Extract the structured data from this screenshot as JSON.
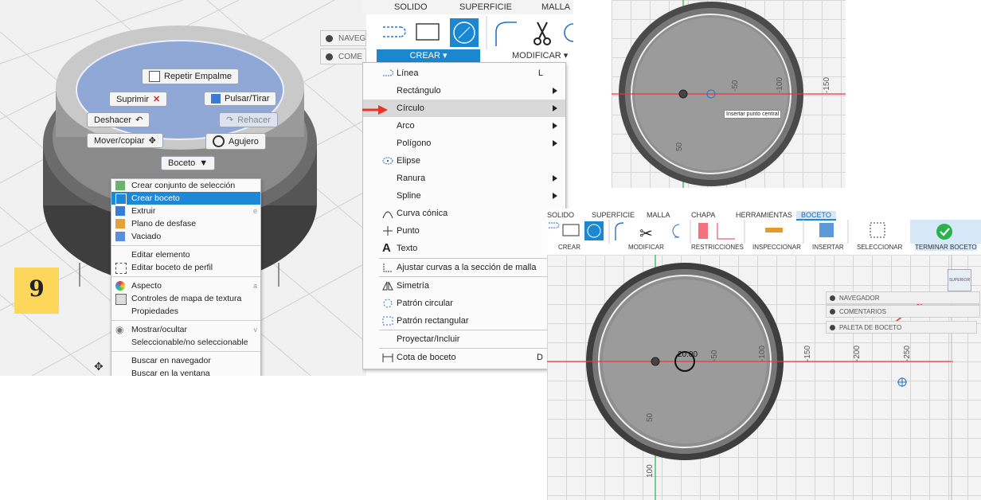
{
  "step_badge": "9",
  "panel1": {
    "nav_mini": [
      "NAVEG",
      "COME"
    ],
    "marking_menu": {
      "repeat": "Repetir Empalme",
      "delete": "Suprimir",
      "push_pull": "Pulsar/Tirar",
      "undo": "Deshacer",
      "redo": "Rehacer",
      "move": "Mover/copiar",
      "hole": "Agujero",
      "sketch": "Boceto"
    },
    "context_menu": {
      "groups": [
        [
          {
            "label": "Crear conjunto de selección",
            "icon": "selection-set-icon"
          },
          {
            "label": "Crear boceto",
            "icon": "sketch-icon",
            "selected": true
          },
          {
            "label": "Extruir",
            "icon": "extrude-icon",
            "shortcut": "e"
          },
          {
            "label": "Plano de desfase",
            "icon": "offset-plane-icon"
          },
          {
            "label": "Vaciado",
            "icon": "shell-icon"
          }
        ],
        [
          {
            "label": "Editar elemento",
            "icon": ""
          },
          {
            "label": "Editar boceto de perfil",
            "icon": "edit-profile-icon"
          }
        ],
        [
          {
            "label": "Aspecto",
            "icon": "appearance-icon",
            "shortcut": "a"
          },
          {
            "label": "Controles de mapa de textura",
            "icon": "texture-icon"
          },
          {
            "label": "Propiedades",
            "icon": ""
          }
        ],
        [
          {
            "label": "Mostrar/ocultar",
            "icon": "eye-icon",
            "shortcut": "v"
          },
          {
            "label": "Seleccionable/no seleccionable",
            "icon": ""
          }
        ],
        [
          {
            "label": "Buscar en navegador",
            "icon": ""
          },
          {
            "label": "Buscar en la ventana",
            "icon": ""
          }
        ]
      ]
    }
  },
  "panel2": {
    "tabs": [
      "SOLIDO",
      "SUPERFICIE",
      "MALLA"
    ],
    "crear": "CREAR",
    "modificar": "MODIFICAR",
    "items": [
      {
        "label": "Línea",
        "key": "L",
        "icon": "line-icon"
      },
      {
        "label": "Rectángulo",
        "sub": true
      },
      {
        "label": "Círculo",
        "sub": true,
        "highlight": true
      },
      {
        "label": "Arco",
        "sub": true
      },
      {
        "label": "Polígono",
        "sub": true
      },
      {
        "label": "Elipse",
        "icon": "ellipse-icon"
      },
      {
        "label": "Ranura",
        "sub": true
      },
      {
        "label": "Spline",
        "sub": true
      },
      {
        "label": "Curva cónica",
        "icon": "conic-icon"
      },
      {
        "label": "Punto",
        "icon": "point-icon"
      },
      {
        "label": "Texto",
        "icon": "text-icon"
      },
      {
        "label": "Ajustar curvas a la sección de malla",
        "icon": "fit-curves-icon",
        "sep_before": true
      },
      {
        "label": "Simetría",
        "icon": "mirror-icon",
        "sep_before": true
      },
      {
        "label": "Patrón circular",
        "icon": "circular-pattern-icon"
      },
      {
        "label": "Patrón rectangular",
        "icon": "rect-pattern-icon"
      },
      {
        "label": "Proyectar/Incluir",
        "sep_before": true
      },
      {
        "label": "Cota de boceto",
        "key": "D",
        "icon": "dimension-icon",
        "sep_before": true
      }
    ]
  },
  "panel3": {
    "tooltip": "Insertar punto central",
    "labels": [
      "-50",
      "-100",
      "-150",
      "50"
    ]
  },
  "panel4": {
    "tabs": [
      "SOLIDO",
      "SUPERFICIE",
      "MALLA",
      "CHAPA",
      "HERRAMIENTAS",
      "BOCETO"
    ],
    "active_tab": "BOCETO",
    "groups": [
      "CREAR",
      "MODIFICAR",
      "RESTRICCIONES",
      "INSPECCIONAR",
      "INSERTAR",
      "SELECCIONAR",
      "TERMINAR BOCETO"
    ],
    "side_panels": [
      "NAVEGADOR",
      "COMENTARIOS",
      "PALETA DE BOCETO"
    ],
    "viewcube": "SUPERIOR",
    "dim_value": "20.00",
    "axis_labels": [
      "-50",
      "-100",
      "-150",
      "-200",
      "-250",
      "50",
      "100"
    ]
  },
  "colors": {
    "accent": "#1b87d0",
    "selected": "#1e88d6",
    "badge": "#fcd75b",
    "marking_menu": "#8fa8d6",
    "finish_green": "#2bb24c"
  }
}
